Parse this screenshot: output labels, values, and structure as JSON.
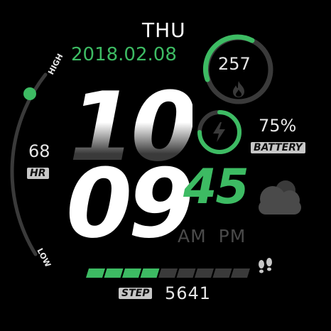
{
  "date": {
    "weekday": "THU",
    "full": "2018.02.08"
  },
  "time": {
    "hour": "10",
    "minute": "09",
    "second": "45",
    "am_label": "AM",
    "pm_label": "PM"
  },
  "calories": {
    "value": "257",
    "icon": "flame-icon"
  },
  "battery": {
    "value": "75%",
    "label": "BATTERY",
    "icon": "lightning-icon"
  },
  "heart_rate": {
    "value": "68",
    "label": "HR",
    "scale_high": "HIGH",
    "scale_low": "LOW",
    "level": 0.8
  },
  "steps": {
    "value": "5641",
    "label": "STEP",
    "icon": "footprints-icon",
    "segments_filled": 4,
    "segments_total": 9
  },
  "weather": {
    "icon": "cloud-icon"
  },
  "colors": {
    "accent": "#3dbb63",
    "track": "#3a3a3a",
    "text": "#e6e6e6"
  }
}
